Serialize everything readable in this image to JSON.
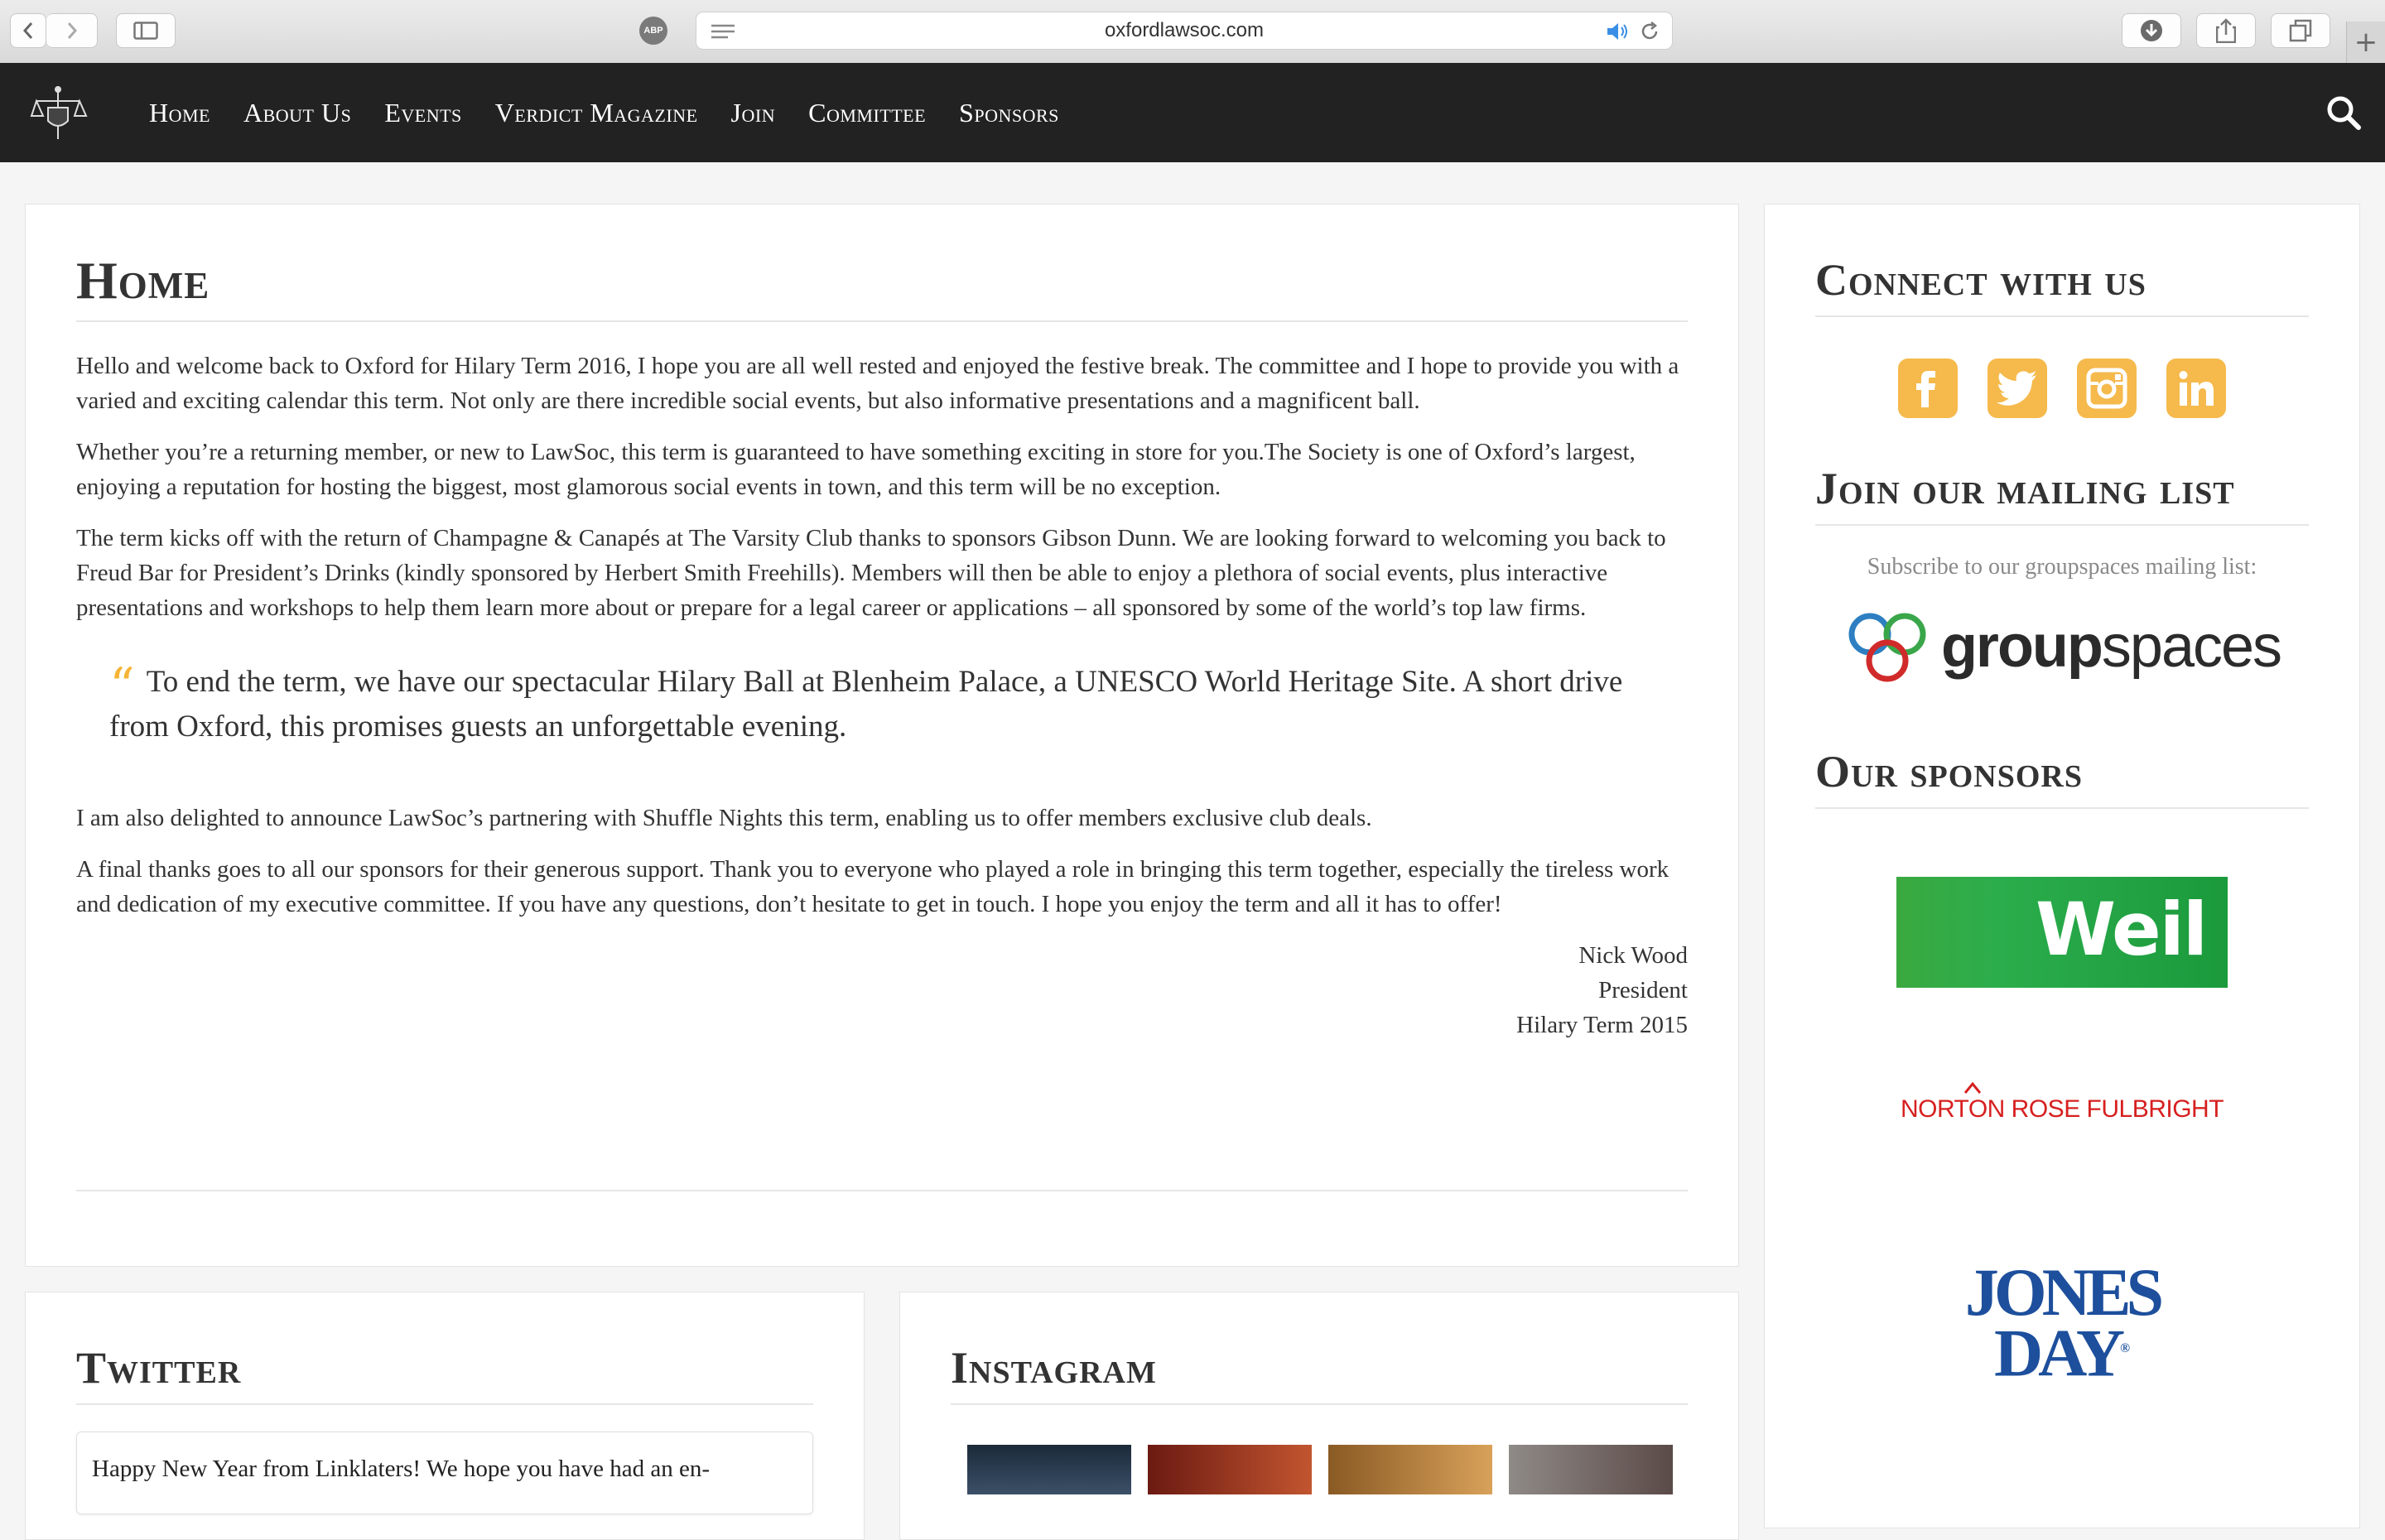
{
  "browser": {
    "url": "oxfordlawsoc.com",
    "adblock_label": "ABP",
    "new_tab_symbol": "+"
  },
  "nav": {
    "items": [
      {
        "label": "Home"
      },
      {
        "label": "About Us"
      },
      {
        "label": "Events"
      },
      {
        "label": "Verdict Magazine"
      },
      {
        "label": "Join"
      },
      {
        "label": "Committee"
      },
      {
        "label": "Sponsors"
      }
    ]
  },
  "main": {
    "title": "Home",
    "paragraphs": [
      "Hello and welcome back to Oxford for Hilary Term 2016, I hope you are all well rested and enjoyed the festive break. The committee and I hope to provide you with a varied and exciting calendar this term. Not only are there incredible social events, but also informative presentations and a magnificent ball.",
      "Whether you’re a returning member, or new to LawSoc, this term is guaranteed to have something exciting in store for you.The Society is one of Oxford’s largest, enjoying a reputation for hosting the biggest, most glamorous social events in town, and this term will be no exception.",
      "The term kicks off with the return of Champagne & Canapés at The Varsity Club thanks to sponsors Gibson Dunn. We are looking forward to welcoming you back to Freud Bar for President’s Drinks (kindly sponsored by Herbert Smith Freehills). Members will then be able to enjoy a plethora of social events, plus interactive presentations and workshops to help them learn more about or prepare for a legal career or applications – all sponsored by some of the world’s top law firms."
    ],
    "quote": "To end the term, we have our spectacular Hilary Ball at Blenheim Palace, a UNESCO World Heritage Site. A short drive from Oxford, this promises guests an unforgettable evening.",
    "quote_mark": "“",
    "paragraphs_after": [
      "I am also delighted to announce LawSoc’s partnering with Shuffle Nights this term, enabling us to offer members exclusive club deals.",
      "A final thanks goes to all our sponsors for their generous support. Thank you to everyone who played a role in bringing this term together, especially the tireless work and dedication of my executive committee. If you have any questions, don’t hesitate to get in touch. I hope you enjoy the term and all it has to offer!"
    ],
    "signature": {
      "name": "Nick Wood",
      "role": "President",
      "term": "Hilary Term 2015"
    }
  },
  "sidebar": {
    "connect_title": "Connect with us",
    "social": [
      "facebook-icon",
      "twitter-icon",
      "instagram-icon",
      "linkedin-icon"
    ],
    "mailing_title": "Join our mailing list",
    "subscribe_text": "Subscribe to our groupspaces mailing list:",
    "groupspaces_bold": "group",
    "groupspaces_light": "spaces",
    "sponsors_title": "Our sponsors",
    "sponsors": {
      "weil": "Weil",
      "norton": "NORTON ROSE FULBRIGHT",
      "jones_line1": "JONES",
      "jones_line2": "DAY",
      "jones_reg": "®"
    },
    "accent_color": "#f5b94c"
  },
  "twitter": {
    "title": "Twitter",
    "tweet": "Happy New Year from Linklaters! We hope you have had an en-"
  },
  "instagram": {
    "title": "Instagram"
  }
}
